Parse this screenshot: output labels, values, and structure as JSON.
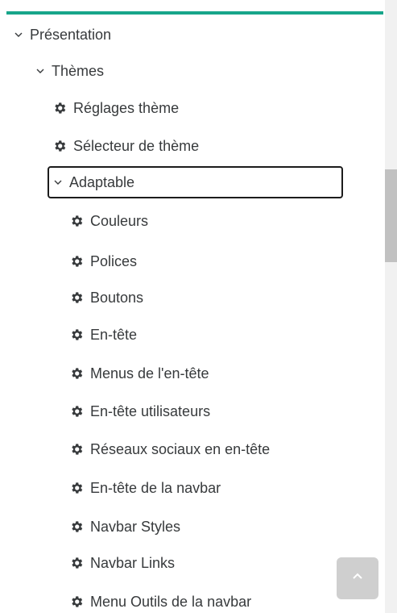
{
  "tree": {
    "presentation": {
      "label": "Présentation",
      "expanded": true
    },
    "themes": {
      "label": "Thèmes",
      "expanded": true
    },
    "theme_settings": {
      "label": "Réglages thème"
    },
    "theme_selector": {
      "label": "Sélecteur de thème"
    },
    "adaptable": {
      "label": "Adaptable",
      "expanded": true,
      "focused": true
    },
    "adaptable_children": [
      {
        "label": "Couleurs"
      },
      {
        "label": "Polices"
      },
      {
        "label": "Boutons"
      },
      {
        "label": "En-tête"
      },
      {
        "label": "Menus de l'en-tête"
      },
      {
        "label": "En-tête utilisateurs"
      },
      {
        "label": "Réseaux sociaux en en-tête"
      },
      {
        "label": "En-tête de la navbar"
      },
      {
        "label": "Navbar Styles"
      },
      {
        "label": "Navbar Links"
      },
      {
        "label": "Menu Outils de la navbar"
      }
    ]
  },
  "scroll_to_top": {
    "icon": "chevron-up-icon"
  },
  "colors": {
    "accent": "#17a58a",
    "text": "#373a3c",
    "focus_border": "#1c1c1c"
  }
}
